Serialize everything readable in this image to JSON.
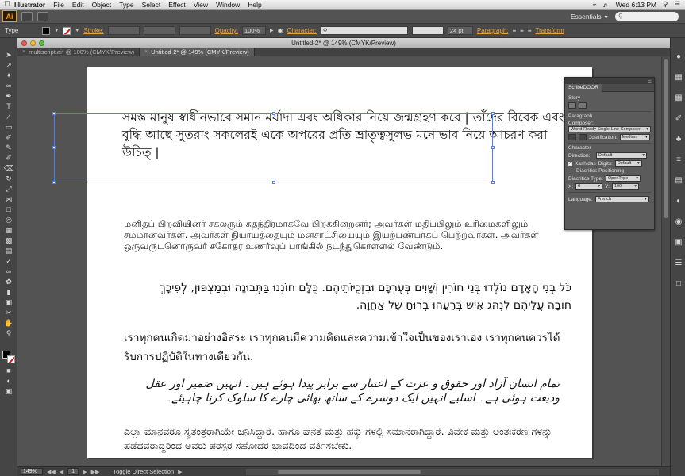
{
  "menubar": {
    "app": "Illustrator",
    "menus": [
      "File",
      "Edit",
      "Object",
      "Type",
      "Select",
      "Effect",
      "View",
      "Window",
      "Help"
    ],
    "clock": "Wed 6:13 PM"
  },
  "appbar": {
    "logo": "Ai",
    "workspace": "Essentials"
  },
  "controlbar": {
    "type_label": "Type",
    "stroke_label": "Stroke:",
    "opacity_label": "Opacity:",
    "opacity_value": "100%",
    "character_label": "Character:",
    "font_size": "24 pt",
    "paragraph_label": "Paragraph:",
    "transform_label": "Transform"
  },
  "document": {
    "window_title": "Untitled-2* @ 149% (CMYK/Preview)",
    "tabs": [
      {
        "label": "multiscript.ai* @ 100% (CMYK/Preview)",
        "active": false
      },
      {
        "label": "Untitled-2* @ 149% (CMYK/Preview)",
        "active": true
      }
    ],
    "zoom": "149%",
    "page": "1",
    "status": "Toggle Direct Selection"
  },
  "artboard": {
    "bengali": "সমস্ত মানুষ স্বাধীনভাবে সমান মর্যাদা এবং অধিকার নিয়ে জন্মগ্রহণ করে | তাঁদের বিবেক এবং বুদ্ধি আছে সুতরাং সকলেরই একে অপরের প্রতি ভ্রাতৃত্বসুলভ মনোভাব নিয়ে আচরণ করা উচিত্ |",
    "tamil": "மனிதப் பிறவியினர் சகலரும் சுதந்திரமாகவே பிறக்கின்றனர்; அவர்கள் மதிப்பிலும் உரிமைகளிலும் சமமானவர்கள். அவர்கள் நியாயத்தையும் மனசாட்சியையும் இயற்பண்பாகப் பெற்றவர்கள். அவர்கள் ஒருவருடனொருவர் சகோதர உணர்வுப் பாங்கில் நடந்துகொள்ளல் வேண்டும்.",
    "hebrew": "כֹּל בְּנֵי הָאָדָם נוֹלְדוּ בְּנֵי חוֹרִין וְשָׁוִים בְּעֶרְכָּם וּבִזְכֻיּוֹתֵיהֶם. כֻּלָּם חוֹנְנוּ בַּתְּבוּנָה וּבְמַצְפּוּן, לְפִיכָךְ חוֹבָה עֲלֵיהֶם לִנְהֹג אִישׁ בְּרֵעֵהוּ בְּרוּחַ שֶׁל אַחֲוָה.",
    "thai": "เราทุกคนเกิดมาอย่างอิสระ เราทุกคนมีความคิดและความเข้าใจเป็นของเราเอง เราทุกคนควรได้รับการปฏิบัติในทางเดียวกัน.",
    "urdu": "تمام انسان آزاد اور حقوق و عزت کے اعتبار سے برابر پیدا ہوئے ہیں۔ انہیں ضمیر اور عقل ودیعت ہوئی ہے۔ اسلیے انہیں ایک دوسرے کے ساتھ بھائی چارے کا سلوک کرنا چاہیئے۔",
    "kannada": "ಎಲ್ಲಾ ಮಾನವರೂ ಸ್ವತಂತ್ರರಾಗಿಯೇ ಜನಿಸಿದ್ದಾರೆ. ಹಾಗೂ ಘನತೆ ಮತ್ತು ಹಕ್ಕು ಗಳಲ್ಲಿ ಸಮಾನರಾಗಿದ್ದಾರೆ. ವಿವೇಕ ಮತ್ತು ಅಂತಃಕರಣ ಗಳನ್ನು ಪಡೆದವರಾದ್ದರಿಂದ ಅವರು ಪರಸ್ಪರ ಸಹೋದರ ಭಾವದಿಂದ ವರ್ತಿಸಬೇಕು."
  },
  "panel": {
    "title": "ScribeDOOR",
    "story": "Story",
    "paragraph": "Paragraph",
    "composer_label": "Composer:",
    "composer_value": "World-Ready Single-Line Composer",
    "justification_label": "Justification:",
    "justification_value": "Medium",
    "character": "Character",
    "direction_label": "Direction:",
    "direction_value": "Default",
    "kashidas_label": "Kashidas",
    "digits_label": "Digits:",
    "digits_value": "Default",
    "diacritics_heading": "Diacritics Positioning",
    "diacritics_type_label": "Diacritics Type:",
    "diacritics_type_value": "OpenType",
    "x_label": "X:",
    "x_value": "0",
    "y_label": "Y:",
    "y_value": "100",
    "language_label": "Language:",
    "language_value": "French"
  },
  "colors": {
    "selection": "#4d7cff",
    "accent_link": "#e8a23a"
  }
}
